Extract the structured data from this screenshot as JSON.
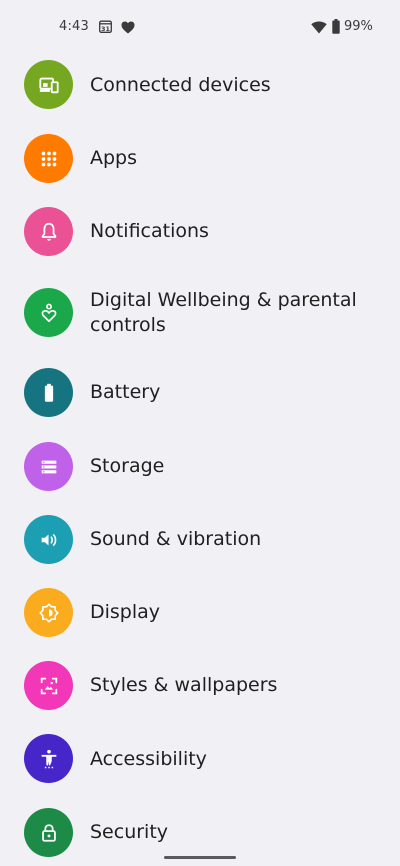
{
  "status_bar": {
    "time": "4:43",
    "calendar_day": "31",
    "battery": "99%"
  },
  "settings_items": [
    {
      "label": "Connected devices",
      "color": "#76a720",
      "icon": "devices-icon"
    },
    {
      "label": "Apps",
      "color": "#ff7b00",
      "icon": "apps-grid-icon"
    },
    {
      "label": "Notifications",
      "color": "#ea5295",
      "icon": "bell-icon"
    },
    {
      "label": "Digital Wellbeing & parental controls",
      "color": "#1ba84a",
      "icon": "wellbeing-icon"
    },
    {
      "label": "Battery",
      "color": "#167380",
      "icon": "battery-icon"
    },
    {
      "label": "Storage",
      "color": "#c061ea",
      "icon": "storage-icon"
    },
    {
      "label": "Sound & vibration",
      "color": "#1c9fb3",
      "icon": "volume-icon"
    },
    {
      "label": "Display",
      "color": "#fbab1e",
      "icon": "brightness-icon"
    },
    {
      "label": "Styles & wallpapers",
      "color": "#f237b8",
      "icon": "wallpaper-icon"
    },
    {
      "label": "Accessibility",
      "color": "#4726c9",
      "icon": "accessibility-icon"
    },
    {
      "label": "Security",
      "color": "#1d8a47",
      "icon": "lock-icon"
    }
  ]
}
